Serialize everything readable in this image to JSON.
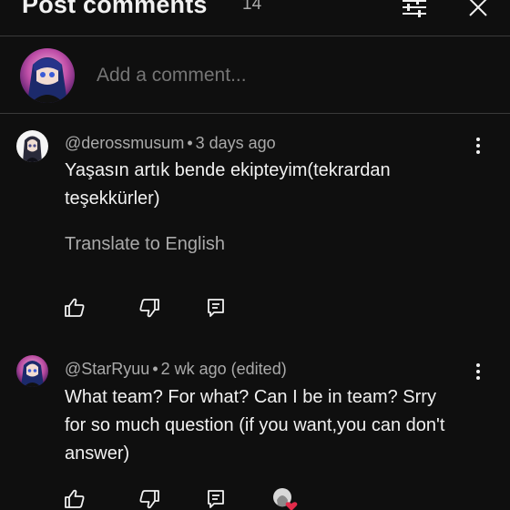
{
  "header": {
    "title": "Post comments",
    "count": "14",
    "filter_icon": "sliders-icon",
    "close_icon": "close-icon"
  },
  "add_comment": {
    "placeholder": "Add a comment..."
  },
  "comments": [
    {
      "author": "@derossmusum",
      "separator": "•",
      "time": "3 days ago",
      "text": "Yaşasın artık bende ekipteyim(tekrardan teşekkürler)",
      "translate": "Translate to English"
    },
    {
      "author": "@StarRyuu",
      "separator": "•",
      "time": "2 wk ago (edited)",
      "text": "What team? For what? Can I be in team? Srry for so much question (if you want,you can don't answer)"
    }
  ],
  "colors": {
    "background": "#0f0f0f",
    "text": "#f1f1f1",
    "secondary": "#aaaaaa",
    "divider": "#3a3a3a",
    "heart": "#e32b4a"
  }
}
